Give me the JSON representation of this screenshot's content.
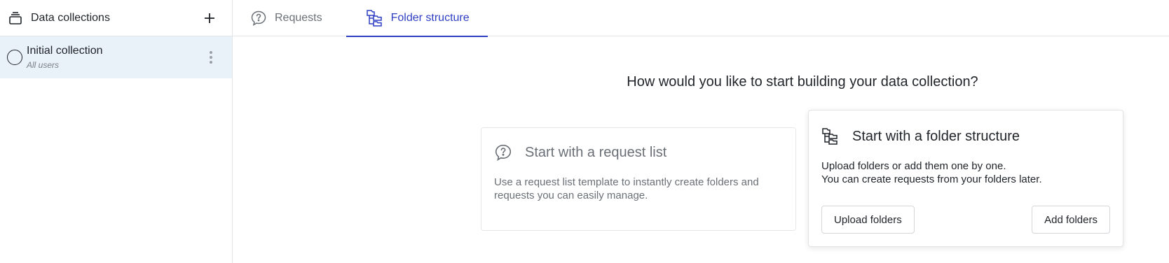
{
  "sidebar": {
    "title": "Data collections",
    "collections": [
      {
        "name": "Initial collection",
        "subtitle": "All users"
      }
    ]
  },
  "tabs": [
    {
      "label": "Requests",
      "icon": "question-bubble-icon",
      "active": false
    },
    {
      "label": "Folder structure",
      "icon": "folder-tree-icon",
      "active": true
    }
  ],
  "main": {
    "title": "How would you like to start building your data collection?",
    "request_card": {
      "heading": "Start with a request list",
      "description": "Use a request list template to instantly create folders and requests you can easily manage."
    },
    "folder_card": {
      "heading": "Start with a folder structure",
      "description_line1": "Upload folders or add them one by one.",
      "description_line2": "You can create requests from your folders later.",
      "upload_label": "Upload folders",
      "add_label": "Add folders"
    }
  },
  "colors": {
    "accent": "#2f3fc4",
    "selected_row": "#e9f2f9",
    "muted_text": "#6b7077"
  }
}
